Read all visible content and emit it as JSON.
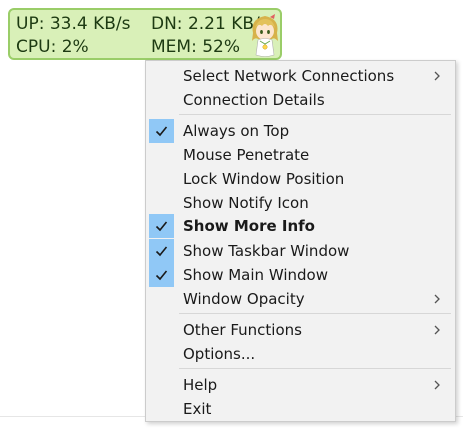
{
  "widget": {
    "up": "UP: 33.4 KB/s",
    "dn": "DN: 2.21 KB/s",
    "cpu": "CPU: 2%",
    "mem": "MEM: 52%",
    "mascot_icon": "anime-mascot-icon",
    "colors": {
      "background": "#d9f0b8",
      "border": "#9acd68",
      "text": "#1d3a12"
    }
  },
  "menu": {
    "items": [
      {
        "label": "Select Network Connections",
        "checked": false,
        "submenu": true
      },
      {
        "label": "Connection Details",
        "checked": false,
        "submenu": false
      },
      {
        "label": "Always on Top",
        "checked": true,
        "submenu": false
      },
      {
        "label": "Mouse Penetrate",
        "checked": false,
        "submenu": false
      },
      {
        "label": "Lock Window Position",
        "checked": false,
        "submenu": false
      },
      {
        "label": "Show Notify Icon",
        "checked": false,
        "submenu": false
      },
      {
        "label": "Show More Info",
        "checked": true,
        "submenu": false,
        "bold": true
      },
      {
        "label": "Show Taskbar Window",
        "checked": true,
        "submenu": false
      },
      {
        "label": "Show Main Window",
        "checked": true,
        "submenu": false
      },
      {
        "label": "Window Opacity",
        "checked": false,
        "submenu": true
      },
      {
        "label": "Other Functions",
        "checked": false,
        "submenu": true
      },
      {
        "label": "Options...",
        "checked": false,
        "submenu": false
      },
      {
        "label": "Help",
        "checked": false,
        "submenu": true
      },
      {
        "label": "Exit",
        "checked": false,
        "submenu": false
      }
    ],
    "colors": {
      "check_highlight": "#90c8f6",
      "background": "#f2f2f2"
    }
  }
}
